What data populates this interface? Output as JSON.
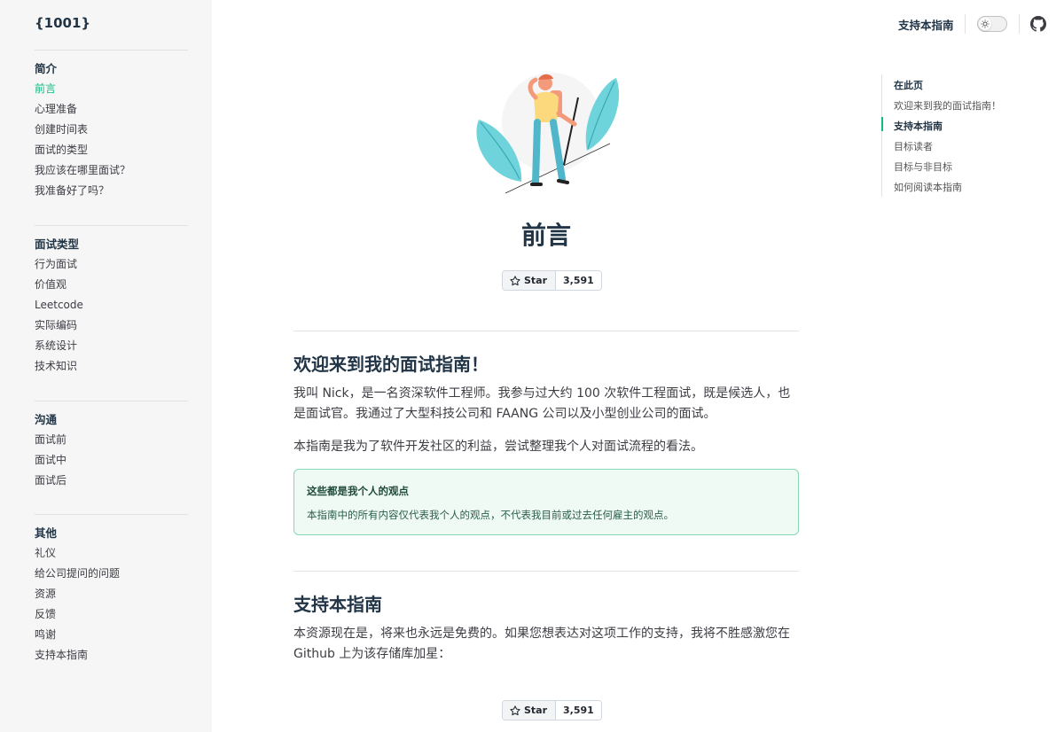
{
  "site": {
    "logo": "{1001}"
  },
  "header": {
    "support_link": "支持本指南"
  },
  "sidebar": {
    "groups": [
      {
        "title": "简介",
        "items": [
          "前言",
          "心理准备",
          "创建时间表",
          "面试的类型",
          "我应该在哪里面试？",
          "我准备好了吗？"
        ]
      },
      {
        "title": "面试类型",
        "items": [
          "行为面试",
          "价值观",
          "Leetcode",
          "实际编码",
          "系统设计",
          "技术知识"
        ]
      },
      {
        "title": "沟通",
        "items": [
          "面试前",
          "面试中",
          "面试后"
        ]
      },
      {
        "title": "其他",
        "items": [
          "礼仪",
          "给公司提问的问题",
          "资源",
          "反馈",
          "鸣谢",
          "支持本指南"
        ]
      }
    ],
    "active": "前言"
  },
  "outline": {
    "title": "在此页",
    "items": [
      "欢迎来到我的面试指南！",
      "支持本指南",
      "目标读者",
      "目标与非目标",
      "如何阅读本指南"
    ],
    "active": "支持本指南"
  },
  "main": {
    "title": "前言",
    "star": {
      "label": "Star",
      "count": "3,591"
    },
    "section1": {
      "heading": "欢迎来到我的面试指南！",
      "p1": "我叫 Nick，是一名资深软件工程师。我参与过大约 100 次软件工程面试，既是候选人，也是面试官。我通过了大型科技公司和 FAANG 公司以及小型创业公司的面试。",
      "p2": "本指南是我为了软件开发社区的利益，尝试整理我个人对面试流程的看法。",
      "callout_title": "这些都是我个人的观点",
      "callout_text": "本指南中的所有内容仅代表我个人的观点，不代表我目前或过去任何雇主的观点。"
    },
    "section2": {
      "heading": "支持本指南",
      "p1": "本资源现在是，将来也永远是免费的。如果您想表达对这项工作的支持，我将不胜感激您在 Github 上为该存储库加星："
    }
  },
  "colors": {
    "accent": "#10b981",
    "text": "#213547",
    "sidebar_bg": "#f6f6f7"
  }
}
